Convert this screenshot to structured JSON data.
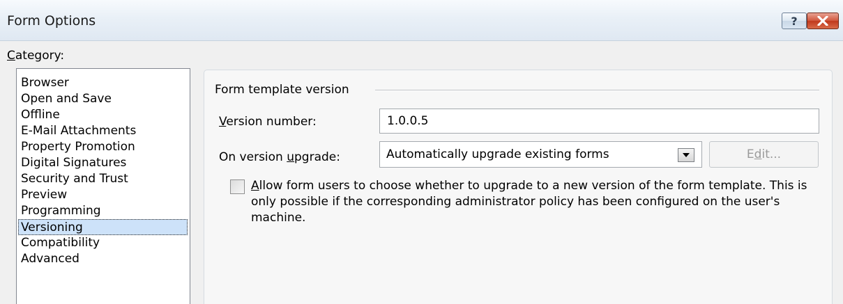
{
  "window": {
    "title": "Form Options",
    "help_label": "?"
  },
  "category": {
    "label_accel": "C",
    "label_rest": "ategory:",
    "items": [
      {
        "label": "Browser"
      },
      {
        "label": "Open and Save"
      },
      {
        "label": "Offline"
      },
      {
        "label": "E-Mail Attachments"
      },
      {
        "label": "Property Promotion"
      },
      {
        "label": "Digital Signatures"
      },
      {
        "label": "Security and Trust"
      },
      {
        "label": "Preview"
      },
      {
        "label": "Programming"
      },
      {
        "label": "Versioning"
      },
      {
        "label": "Compatibility"
      },
      {
        "label": "Advanced"
      }
    ],
    "selected": "Versioning"
  },
  "versioning": {
    "group_title": "Form template version",
    "version_label_accel": "V",
    "version_label_rest": "ersion number:",
    "version_value": "1.0.0.5",
    "upgrade_label_pre": "On version ",
    "upgrade_label_accel": "u",
    "upgrade_label_rest": "pgrade:",
    "upgrade_value": "Automatically upgrade existing forms",
    "edit_pre": "E",
    "edit_accel": "d",
    "edit_rest": "it...",
    "edit_enabled": false,
    "allow_checked": false,
    "allow_accel": "A",
    "allow_text": "llow form users to choose whether to upgrade to a new version of the form template. This is only possible if the corresponding administrator policy has been configured on the user's machine."
  }
}
